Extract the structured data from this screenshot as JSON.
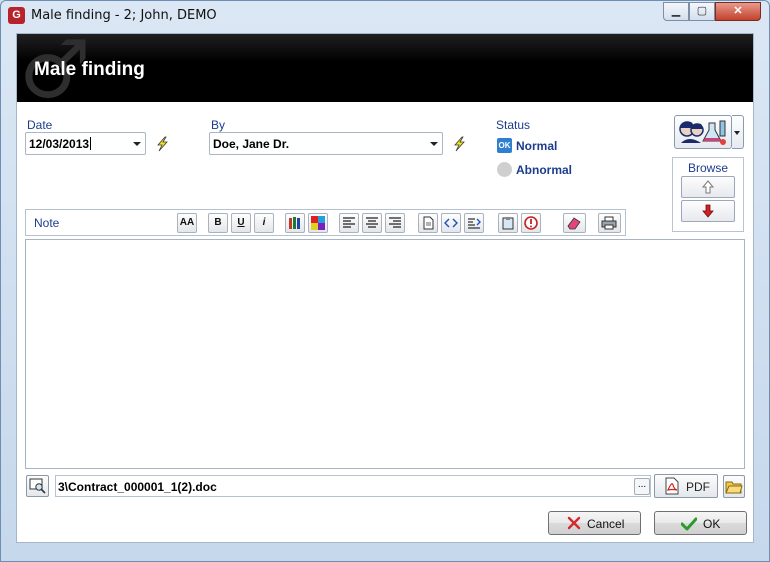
{
  "window": {
    "title": "Male finding - 2; John, DEMO",
    "app_icon_glyph": "G",
    "controls": {
      "minimize": "▁",
      "maximize": "▢",
      "close": "✕"
    }
  },
  "banner": {
    "title": "Male finding",
    "symbol": "♂",
    "background": "#000000"
  },
  "date": {
    "label": "Date",
    "value": "12/03/2013"
  },
  "by": {
    "label": "By",
    "value": "Doe, Jane Dr."
  },
  "status": {
    "label": "Status",
    "ok_badge": "OK",
    "options": [
      {
        "label": "Normal",
        "selected": true
      },
      {
        "label": "Abnormal",
        "selected": false
      }
    ]
  },
  "browse": {
    "label": "Browse",
    "up_icon": "arrow-up-icon",
    "down_icon": "arrow-down-icon"
  },
  "note_toolbar": {
    "label": "Note",
    "font_btn": "AA",
    "bold_btn": "B",
    "underline_btn": "U",
    "italic_btn": "i"
  },
  "note_text": "",
  "attachment": {
    "file": "3\\Contract_000001_1(2).doc",
    "ellipsis": "...",
    "pdf_label": "PDF"
  },
  "buttons": {
    "cancel": "Cancel",
    "ok": "OK"
  },
  "colors": {
    "label_blue": "#1c3d8c",
    "ok_badge": "#2f7fd0",
    "cancel_x": "#d12b2b",
    "ok_check": "#2e9a2e"
  }
}
